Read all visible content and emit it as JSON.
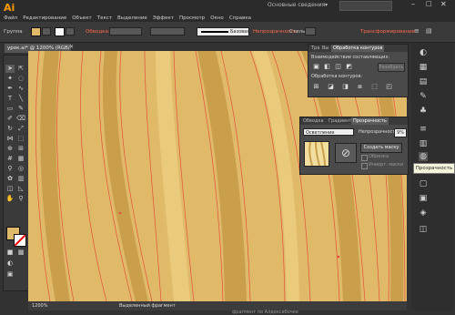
{
  "app": {
    "logo": "Ai",
    "workspace": "Основные сведения"
  },
  "menu": [
    "Файл",
    "Редактирование",
    "Объект",
    "Текст",
    "Выделение",
    "Эффект",
    "Просмотр",
    "Окно",
    "Справка"
  ],
  "controlbar": {
    "group_label": "Группа",
    "stroke_label": "Обводка:",
    "brush_label": "Базовая",
    "opacity_label": "Непрозрачность:",
    "styles_label": "Стиль:",
    "transform_label": "Трансформирование",
    "fill_color": "#e0b969"
  },
  "document": {
    "tab_title": "урок.ai* @ 1200% (RGB/Просмотр)"
  },
  "pathfinder": {
    "tabs": [
      "Тра",
      "Вы",
      "Обработка контуров"
    ],
    "shape_modes_label": "Взаимодействие составляющих:",
    "expand_label": "Разобрать",
    "pathfinders_label": "Обработка контуров:"
  },
  "transparency": {
    "tabs": [
      "Обводка",
      "Градиент",
      "Прозрачность"
    ],
    "blend_mode": "Осветление",
    "opacity_label": "Непрозрачность:",
    "opacity_value": "9%",
    "make_mask_label": "Создать маску",
    "clip_label": "Обрезка",
    "invert_label": "Инверт. маски"
  },
  "tooltip": "Прозрачность",
  "status": {
    "zoom": "1200%",
    "tool": "Выделенный фрагмент"
  },
  "caption": "фрагмент по Алдексабочке",
  "colors": {
    "canvas": "#e0b969",
    "grain_dark": "#c99f4c",
    "grain_light": "#eacb7c",
    "path": "#e4513c",
    "accent": "#ff9a00"
  }
}
